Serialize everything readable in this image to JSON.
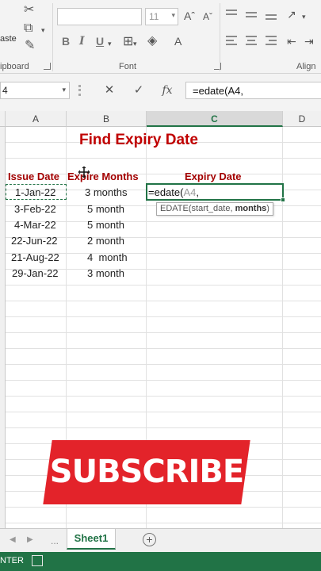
{
  "ribbon": {
    "paste_label": "aste",
    "clipboard_label": "ipboard",
    "font_group_label": "Font",
    "alignment_group_label": "Align",
    "font_size": "11",
    "bold": "B",
    "italic": "I",
    "underline": "U"
  },
  "formula_bar": {
    "name_box": "4",
    "formula": "=edate(A4,"
  },
  "columns": [
    "A",
    "B",
    "C",
    "D"
  ],
  "sheet": {
    "title": "Find Expiry Date",
    "headers": {
      "issue_date": "Issue Date",
      "expire_months": "Expire Months",
      "expiry_date": "Expiry Date"
    },
    "rows": [
      {
        "issue": "1-Jan-22",
        "months": "3 months"
      },
      {
        "issue": "3-Feb-22",
        "months": "5 month"
      },
      {
        "issue": "4-Mar-22",
        "months": "5 month"
      },
      {
        "issue": "22-Jun-22",
        "months": "2 month"
      },
      {
        "issue": "21-Aug-22",
        "months": "4  month"
      },
      {
        "issue": "29-Jan-22",
        "months": "3 month"
      }
    ],
    "editing_prefix": "=edate(",
    "editing_ref": "A4",
    "editing_suffix": ",",
    "tooltip_fn": "EDATE(start_date, ",
    "tooltip_arg": "months",
    "tooltip_close": ")"
  },
  "banner": {
    "text": "SUBSCRIBE",
    "color": "#e3232a"
  },
  "tabs": {
    "sheet1": "Sheet1",
    "add": "+",
    "dots": "..."
  },
  "status": {
    "mode": "NTER"
  },
  "colors": {
    "accent": "#217346",
    "title": "#c00000"
  }
}
